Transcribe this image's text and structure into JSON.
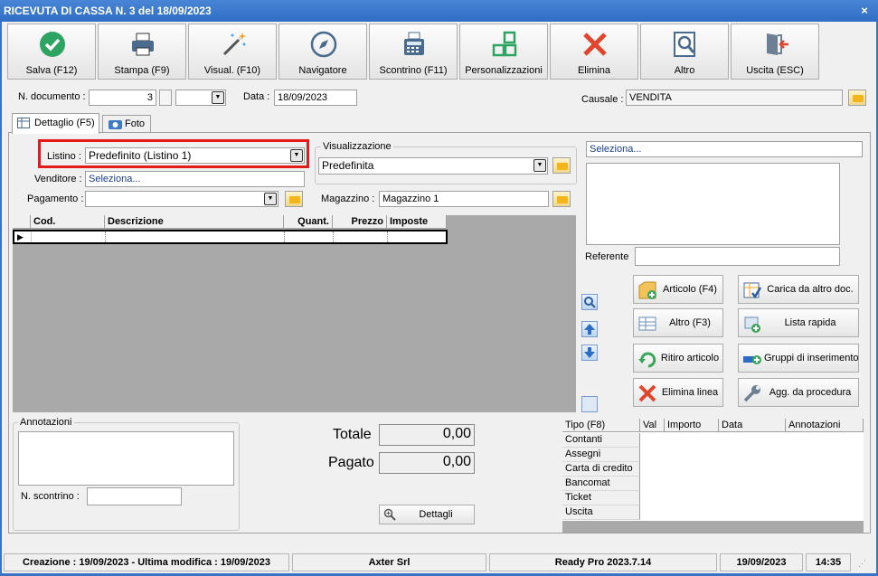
{
  "window": {
    "title": "RICEVUTA DI CASSA N. 3 del 18/09/2023",
    "close": "×"
  },
  "toolbar": [
    {
      "label": "Salva (F12)",
      "icon": "check-icon"
    },
    {
      "label": "Stampa (F9)",
      "icon": "printer-icon"
    },
    {
      "label": "Visual. (F10)",
      "icon": "magic-wand-icon"
    },
    {
      "label": "Navigatore",
      "icon": "compass-icon"
    },
    {
      "label": "Scontrino (F11)",
      "icon": "cash-register-icon"
    },
    {
      "label": "Personalizzazioni",
      "icon": "grid-icon"
    },
    {
      "label": "Elimina",
      "icon": "delete-icon"
    },
    {
      "label": "Altro",
      "icon": "magnify-icon"
    },
    {
      "label": "Uscita (ESC)",
      "icon": "exit-icon"
    }
  ],
  "header": {
    "doc_label": "N. documento :",
    "doc_value": "3",
    "date_label": "Data :",
    "date_value": "18/09/2023",
    "causale_label": "Causale :",
    "causale_value": "VENDITA"
  },
  "tabs": [
    {
      "label": "Dettaglio (F5)"
    },
    {
      "label": "Foto"
    }
  ],
  "form": {
    "listino_label": "Listino :",
    "listino_value": "Predefinito (Listino 1)",
    "venditore_label": "Venditore :",
    "venditore_value": "Seleziona...",
    "pagamento_label": "Pagamento :",
    "pagamento_value": "",
    "visualizzazione_label": "Visualizzazione",
    "visualizzazione_value": "Predefinita",
    "magazzino_label": "Magazzino :",
    "magazzino_value": "Magazzino 1",
    "right_select": "Seleziona...",
    "referente_label": "Referente",
    "referente_value": ""
  },
  "grid": {
    "columns": [
      "Cod.",
      "Descrizione",
      "Quant.",
      "Prezzo",
      "Imposte"
    ]
  },
  "actions": [
    {
      "label": "Articolo (F4)",
      "icon": "article-add-icon"
    },
    {
      "label": "Carica da altro doc.",
      "icon": "load-doc-icon"
    },
    {
      "label": "Altro (F3)",
      "icon": "table-icon"
    },
    {
      "label": "Lista rapida",
      "icon": "quick-list-icon"
    },
    {
      "label": "Ritiro articolo",
      "icon": "return-arrow-icon"
    },
    {
      "label": "Gruppi di inserimento",
      "icon": "group-insert-icon"
    },
    {
      "label": "Elimina linea",
      "icon": "delete-line-icon"
    },
    {
      "label": "Agg. da procedura",
      "icon": "wrench-icon"
    }
  ],
  "annotazioni": {
    "label": "Annotazioni",
    "value": "",
    "scontrino_label": "N. scontrino :",
    "scontrino_value": ""
  },
  "totals": {
    "totale_label": "Totale",
    "totale_value": "0,00",
    "pagato_label": "Pagato",
    "pagato_value": "0,00",
    "dettagli_label": "Dettagli"
  },
  "payments": {
    "columns": [
      "Tipo (F8)",
      "Val",
      "Importo",
      "Data",
      "Annotazioni"
    ],
    "rows": [
      "Contanti",
      "Assegni",
      "Carta di credito",
      "Bancomat",
      "Ticket",
      "Uscita"
    ]
  },
  "status": {
    "dates": "Creazione : 19/09/2023 - Ultima modifica : 19/09/2023",
    "company": "Axter Srl",
    "version": "Ready Pro 2023.7.14",
    "date": "19/09/2023",
    "time": "14:35"
  },
  "colors": {
    "titlebar": "#2f6dc3",
    "highlight": "#e31b1b",
    "grid_bg": "#a9a9a9"
  }
}
